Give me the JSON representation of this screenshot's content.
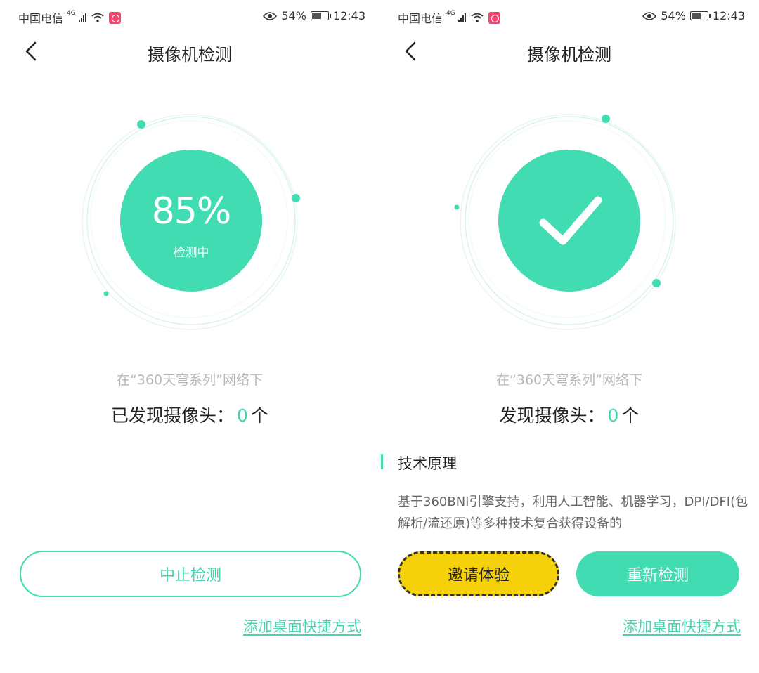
{
  "status_bar": {
    "carrier": "中国电信",
    "network": "4G",
    "battery": "54%",
    "time": "12:43"
  },
  "left_screen": {
    "title": "摄像机检测",
    "progress_text": "85%",
    "progress_value": 0.85,
    "progress_label": "检测中",
    "network_text": "在“360天穹系列”网络下",
    "found_label": "已发现摄像头：",
    "found_count": "0",
    "found_unit": "个",
    "stop_button": "中止检测",
    "shortcut_link": "添加桌面快捷方式"
  },
  "right_screen": {
    "title": "摄像机检测",
    "network_text": "在“360天穹系列”网络下",
    "found_label": "发现摄像头：",
    "found_count": "0",
    "found_unit": "个",
    "tech_title": "技术原理",
    "tech_body": "基于360BNI引擎支持，利用人工智能、机器学习，DPI/DFI(包解析/流还原)等多种技术复合获得设备的",
    "invite_button": "邀请体验",
    "retest_button": "重新检测",
    "shortcut_link": "添加桌面快捷方式"
  },
  "colors": {
    "accent": "#41dcb2",
    "invite": "#f5d10a",
    "muted_text": "#b7b7b7"
  },
  "icons": [
    "back-arrow-icon",
    "signal-icon",
    "wifi-icon",
    "app-notification-icon",
    "eye-icon",
    "battery-icon",
    "check-icon"
  ]
}
